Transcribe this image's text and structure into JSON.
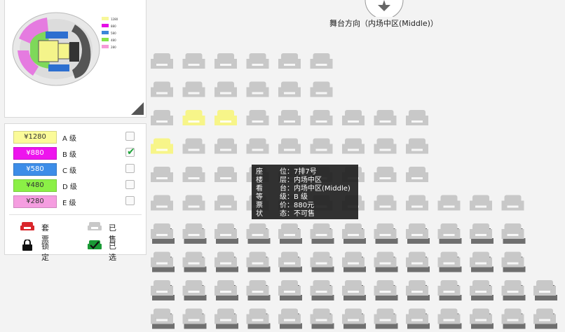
{
  "mini_map": {
    "legend_items": [
      {
        "label": "1280",
        "color": "#f7f79a"
      },
      {
        "label": "880",
        "color": "#e60ee6"
      },
      {
        "label": "580",
        "color": "#3a86d9"
      },
      {
        "label": "480",
        "color": "#86e34a"
      },
      {
        "label": "280",
        "color": "#f59ad8"
      }
    ]
  },
  "prices": [
    {
      "price": "¥1280",
      "grade": "A 级",
      "color": "#fbfb99",
      "text_color": "#333333",
      "checked": false
    },
    {
      "price": "¥880",
      "grade": "B 级",
      "color": "#ee14ee",
      "text_color": "#ffffff",
      "checked": true
    },
    {
      "price": "¥580",
      "grade": "C 级",
      "color": "#3d8de8",
      "text_color": "#ffffff",
      "checked": false
    },
    {
      "price": "¥480",
      "grade": "D 级",
      "color": "#8bf046",
      "text_color": "#333333",
      "checked": false
    },
    {
      "price": "¥280",
      "grade": "E 级",
      "color": "#f59de0",
      "text_color": "#333333",
      "checked": false
    }
  ],
  "status_key": [
    {
      "label": "套票",
      "icon": "package-seat-icon",
      "color": "#d9262b"
    },
    {
      "label": "已售",
      "icon": "sold-seat-icon",
      "color": "#c9c9c9"
    },
    {
      "label": "锁定",
      "icon": "lock-icon",
      "color": "#111111"
    },
    {
      "label": "已选",
      "icon": "selected-seat-icon",
      "color": "#1a9a35"
    }
  ],
  "stage": {
    "label": "舞台方向（内场中区(Middle)）"
  },
  "seat_colors": {
    "sold": "#c8c8c8",
    "available": "#f7f589"
  },
  "seat_rows": [
    {
      "start": 0,
      "count": 6,
      "style": "flat",
      "yellow": []
    },
    {
      "start": 0,
      "count": 6,
      "style": "flat",
      "yellow": []
    },
    {
      "start": 0,
      "count": 9,
      "style": "flat",
      "yellow": [
        1,
        2
      ]
    },
    {
      "start": 0,
      "count": 9,
      "style": "flat",
      "yellow": [
        0
      ]
    },
    {
      "start": 0,
      "count": 9,
      "style": "flat",
      "yellow": []
    },
    {
      "start": 0,
      "count": 12,
      "style": "flat",
      "yellow": []
    },
    {
      "start": 0,
      "count": 12,
      "style": "shadow",
      "yellow": []
    },
    {
      "start": 0,
      "count": 12,
      "style": "shadow",
      "yellow": []
    },
    {
      "start": 0,
      "count": 13,
      "style": "shadow",
      "yellow": []
    },
    {
      "start": 0,
      "count": 13,
      "style": "shadow",
      "yellow": []
    }
  ],
  "tooltip": {
    "rows": [
      {
        "key": "座",
        "value": "位：7排7号"
      },
      {
        "key": "楼",
        "value": "层：内场中区"
      },
      {
        "key": "看",
        "value": "台：内场中区(Middle)"
      },
      {
        "key": "等",
        "value": "级：B 级"
      },
      {
        "key": "票",
        "value": "价：880元"
      },
      {
        "key": "状",
        "value": "态：不可售"
      }
    ]
  }
}
